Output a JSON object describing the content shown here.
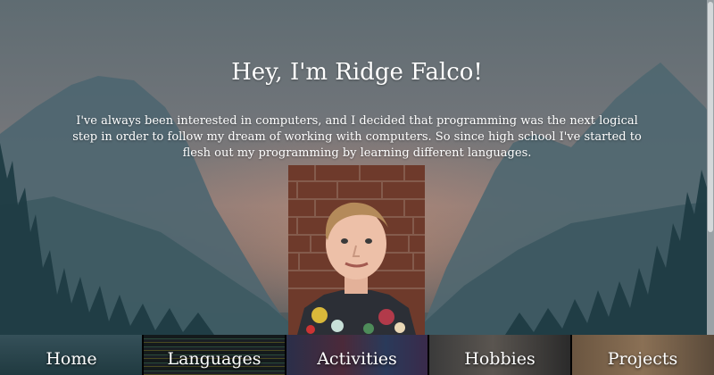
{
  "hero": {
    "title": "Hey, I'm Ridge Falco!",
    "intro": "I've always been interested in computers, and I decided that programming was the next logical step in order to follow my dream of working with computers. So since high school I've started to flesh out my programming by learning different languages."
  },
  "nav": {
    "items": [
      {
        "label": "Home"
      },
      {
        "label": "Languages"
      },
      {
        "label": "Activities"
      },
      {
        "label": "Hobbies"
      },
      {
        "label": "Projects"
      }
    ]
  },
  "colors": {
    "text": "#ffffff",
    "sky": "#6f7479",
    "forest": "#2f4b52"
  }
}
